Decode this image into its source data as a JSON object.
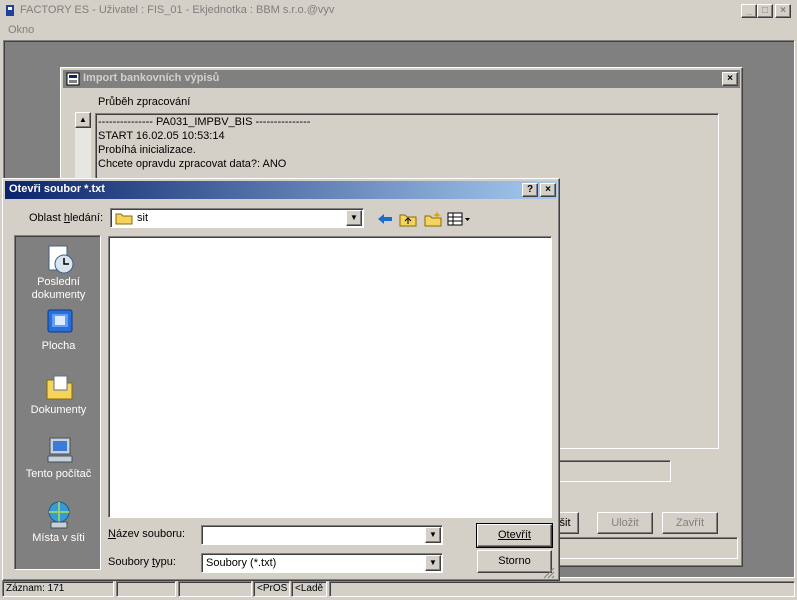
{
  "app": {
    "title": "FACTORY ES - Uživatel : FIS_01 - Ekjednotka : BBM s.r.o.@vyv",
    "menu": [
      "Okno"
    ],
    "title_buttons": {
      "minimize": "_",
      "maximize": "□",
      "close": "×"
    }
  },
  "status": {
    "record": "Záznam: 171",
    "mode": "<PrOS",
    "extra": "<Ladě"
  },
  "import_window": {
    "title": "Import bankovních výpisů",
    "progress_label": "Průběh zpracování",
    "log": [
      "--------------- PA031_IMPBV_BIS ---------------",
      "START 16.02.05 10:53:14",
      "Probíhá inicializace.",
      "Chcete opravdu zpracovat data?: ANO"
    ],
    "buttons": {
      "abort": "ušit",
      "save": "Uložit",
      "close": "Zavřít"
    }
  },
  "file_dialog": {
    "title": "Otevři soubor *.txt",
    "help": "?",
    "close": "×",
    "look_in_label": "Oblast hledání:",
    "look_in_value": "sit",
    "places": [
      {
        "label": "Poslední dokumenty",
        "icon": "recent-documents-icon"
      },
      {
        "label": "Plocha",
        "icon": "desktop-icon"
      },
      {
        "label": "Dokumenty",
        "icon": "documents-folder-icon"
      },
      {
        "label": "Tento počítač",
        "icon": "my-computer-icon"
      },
      {
        "label": "Místa v síti",
        "icon": "network-places-icon"
      }
    ],
    "filename_label": "Název souboru:",
    "filename_value": "",
    "filetype_label": "Soubory typu:",
    "filetype_value": "Soubory (*.txt)",
    "open_label": "Otevřít",
    "cancel_label": "Storno"
  }
}
